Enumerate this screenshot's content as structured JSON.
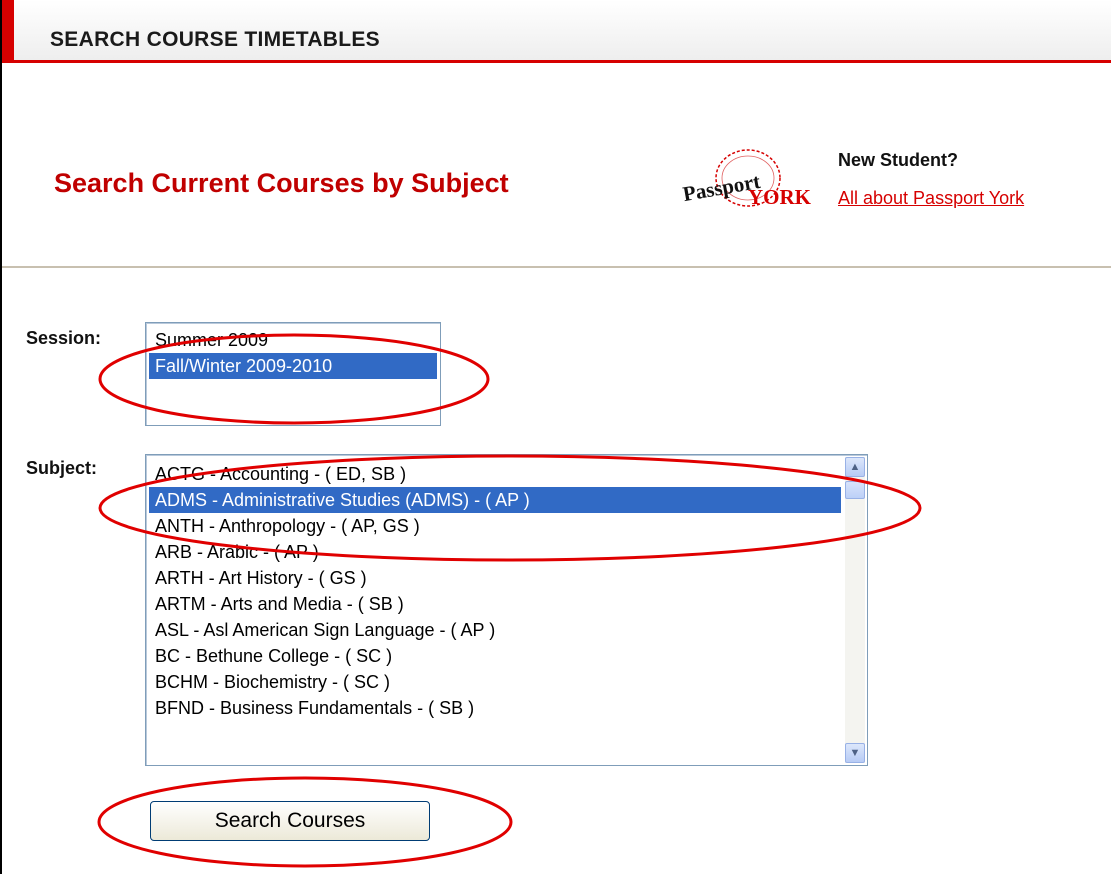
{
  "header": {
    "title": "SEARCH COURSE TIMETABLES"
  },
  "intro": {
    "subtitle": "Search Current Courses by Subject",
    "new_student_label": "New Student?",
    "passport_link": "All about Passport York",
    "logo_text_passport": "Passport",
    "logo_text_york": "YORK"
  },
  "form": {
    "session_label": "Session:",
    "session_options": [
      "Summer 2009",
      "Fall/Winter 2009-2010"
    ],
    "session_selected": "Fall/Winter 2009-2010",
    "subject_label": "Subject:",
    "subject_options": [
      "ACTG - Accounting - ( ED, SB )",
      "ADMS - Administrative Studies (ADMS) - ( AP )",
      "ANTH - Anthropology - ( AP, GS )",
      "ARB - Arabic - ( AP )",
      "ARTH - Art History - ( GS )",
      "ARTM - Arts and Media - ( SB )",
      "ASL - Asl American Sign Language - ( AP )",
      "BC - Bethune College - ( SC )",
      "BCHM - Biochemistry - ( SC )",
      "BFND - Business Fundamentals - ( SB )"
    ],
    "subject_selected": "ADMS - Administrative Studies (ADMS) - ( AP )",
    "search_button": "Search Courses"
  },
  "colors": {
    "accent": "#d60000",
    "subtitle": "#c00000",
    "selection": "#316ac5"
  }
}
